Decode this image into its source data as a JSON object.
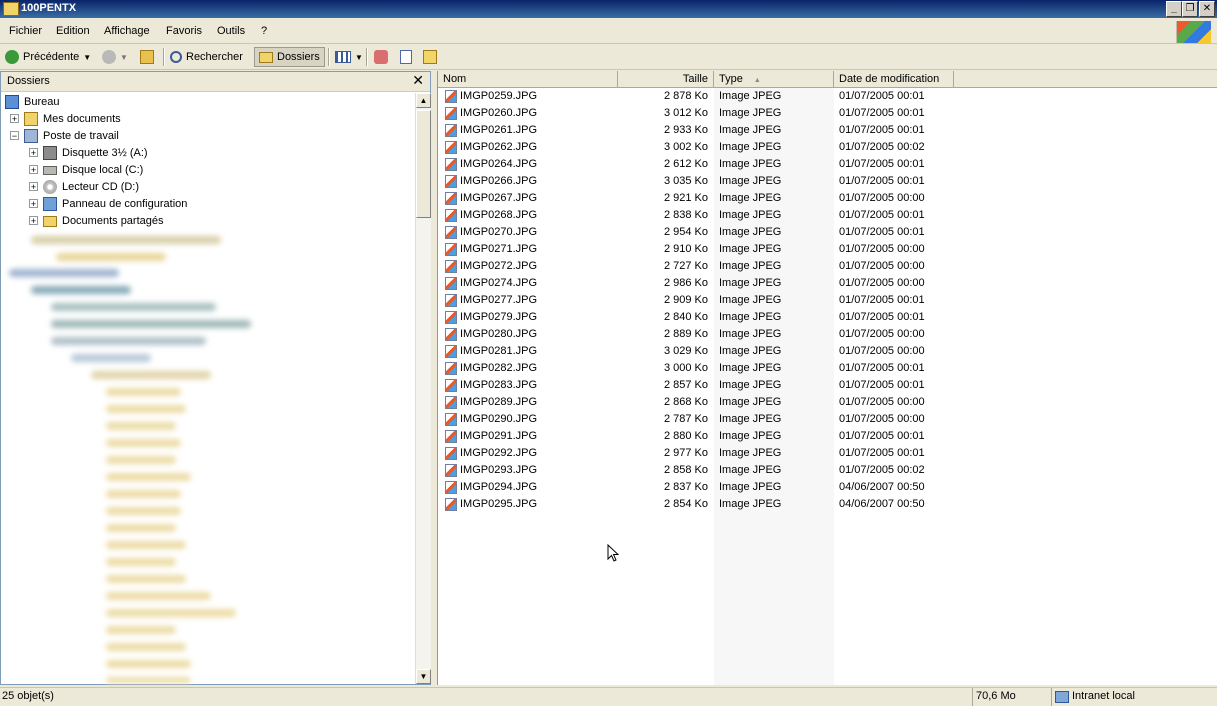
{
  "window": {
    "title": "100PENTX",
    "minimize": "_",
    "restore": "❐",
    "close": "✕"
  },
  "menu": [
    "Fichier",
    "Edition",
    "Affichage",
    "Favoris",
    "Outils",
    "?"
  ],
  "toolbar": {
    "back_label": "Précédente",
    "search_label": "Rechercher",
    "folders_label": "Dossiers"
  },
  "folders_pane": {
    "title": "Dossiers",
    "close": "✕",
    "tree": [
      {
        "label": "Bureau",
        "icon": "desktop-icon",
        "expander": ""
      },
      {
        "label": "Mes documents",
        "icon": "my-documents-icon",
        "expander": "+"
      },
      {
        "label": "Poste de travail",
        "icon": "my-computer-icon",
        "expander": "−"
      },
      {
        "label": "Disquette 3½ (A:)",
        "icon": "floppy-icon",
        "expander": "+"
      },
      {
        "label": "Disque local (C:)",
        "icon": "hard-disk-icon",
        "expander": "+"
      },
      {
        "label": "Lecteur CD (D:)",
        "icon": "cd-drive-icon",
        "expander": "+"
      },
      {
        "label": "Panneau de configuration",
        "icon": "control-panel-icon",
        "expander": "+"
      },
      {
        "label": "Documents partagés",
        "icon": "folder-icon",
        "expander": "+"
      }
    ]
  },
  "columns": {
    "name": "Nom",
    "size": "Taille",
    "type": "Type",
    "modified": "Date de modification"
  },
  "files": [
    {
      "name": "IMGP0259.JPG",
      "size": "2 878 Ko",
      "type": "Image JPEG",
      "modified": "01/07/2005 00:01"
    },
    {
      "name": "IMGP0260.JPG",
      "size": "3 012 Ko",
      "type": "Image JPEG",
      "modified": "01/07/2005 00:01"
    },
    {
      "name": "IMGP0261.JPG",
      "size": "2 933 Ko",
      "type": "Image JPEG",
      "modified": "01/07/2005 00:01"
    },
    {
      "name": "IMGP0262.JPG",
      "size": "3 002 Ko",
      "type": "Image JPEG",
      "modified": "01/07/2005 00:02"
    },
    {
      "name": "IMGP0264.JPG",
      "size": "2 612 Ko",
      "type": "Image JPEG",
      "modified": "01/07/2005 00:01"
    },
    {
      "name": "IMGP0266.JPG",
      "size": "3 035 Ko",
      "type": "Image JPEG",
      "modified": "01/07/2005 00:01"
    },
    {
      "name": "IMGP0267.JPG",
      "size": "2 921 Ko",
      "type": "Image JPEG",
      "modified": "01/07/2005 00:00"
    },
    {
      "name": "IMGP0268.JPG",
      "size": "2 838 Ko",
      "type": "Image JPEG",
      "modified": "01/07/2005 00:01"
    },
    {
      "name": "IMGP0270.JPG",
      "size": "2 954 Ko",
      "type": "Image JPEG",
      "modified": "01/07/2005 00:01"
    },
    {
      "name": "IMGP0271.JPG",
      "size": "2 910 Ko",
      "type": "Image JPEG",
      "modified": "01/07/2005 00:00"
    },
    {
      "name": "IMGP0272.JPG",
      "size": "2 727 Ko",
      "type": "Image JPEG",
      "modified": "01/07/2005 00:00"
    },
    {
      "name": "IMGP0274.JPG",
      "size": "2 986 Ko",
      "type": "Image JPEG",
      "modified": "01/07/2005 00:00"
    },
    {
      "name": "IMGP0277.JPG",
      "size": "2 909 Ko",
      "type": "Image JPEG",
      "modified": "01/07/2005 00:01"
    },
    {
      "name": "IMGP0279.JPG",
      "size": "2 840 Ko",
      "type": "Image JPEG",
      "modified": "01/07/2005 00:01"
    },
    {
      "name": "IMGP0280.JPG",
      "size": "2 889 Ko",
      "type": "Image JPEG",
      "modified": "01/07/2005 00:00"
    },
    {
      "name": "IMGP0281.JPG",
      "size": "3 029 Ko",
      "type": "Image JPEG",
      "modified": "01/07/2005 00:00"
    },
    {
      "name": "IMGP0282.JPG",
      "size": "3 000 Ko",
      "type": "Image JPEG",
      "modified": "01/07/2005 00:01"
    },
    {
      "name": "IMGP0283.JPG",
      "size": "2 857 Ko",
      "type": "Image JPEG",
      "modified": "01/07/2005 00:01"
    },
    {
      "name": "IMGP0289.JPG",
      "size": "2 868 Ko",
      "type": "Image JPEG",
      "modified": "01/07/2005 00:00"
    },
    {
      "name": "IMGP0290.JPG",
      "size": "2 787 Ko",
      "type": "Image JPEG",
      "modified": "01/07/2005 00:00"
    },
    {
      "name": "IMGP0291.JPG",
      "size": "2 880 Ko",
      "type": "Image JPEG",
      "modified": "01/07/2005 00:01"
    },
    {
      "name": "IMGP0292.JPG",
      "size": "2 977 Ko",
      "type": "Image JPEG",
      "modified": "01/07/2005 00:01"
    },
    {
      "name": "IMGP0293.JPG",
      "size": "2 858 Ko",
      "type": "Image JPEG",
      "modified": "01/07/2005 00:02"
    },
    {
      "name": "IMGP0294.JPG",
      "size": "2 837 Ko",
      "type": "Image JPEG",
      "modified": "04/06/2007 00:50"
    },
    {
      "name": "IMGP0295.JPG",
      "size": "2 854 Ko",
      "type": "Image JPEG",
      "modified": "04/06/2007 00:50"
    }
  ],
  "status": {
    "count": "25 objet(s)",
    "total_size": "70,6 Mo",
    "zone": "Intranet local"
  }
}
